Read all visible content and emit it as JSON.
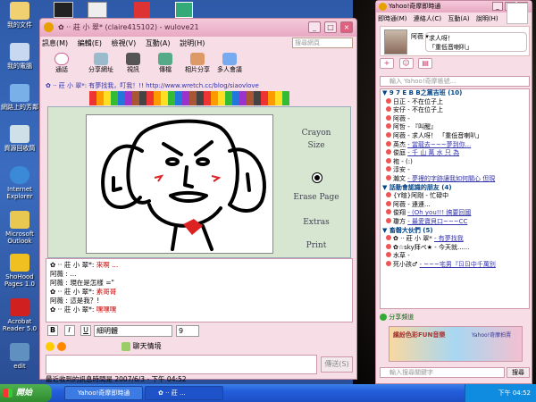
{
  "desktop": {
    "icons": [
      {
        "label": "我的文件"
      },
      {
        "label": "我的電腦"
      },
      {
        "label": "網路上的芳鄰"
      },
      {
        "label": "資源回收筒"
      },
      {
        "label": "Internet Explorer"
      },
      {
        "label": "Microsoft Outlook"
      },
      {
        "label": "ShoHood Pages 1.0"
      },
      {
        "label": "Acrobat Reader 5.0"
      },
      {
        "label": "edit"
      }
    ]
  },
  "chat": {
    "title": "✿ ·· 莊 小 翠* (claire415102) - wulove21",
    "menu": [
      "訊息(M)",
      "編輯(E)",
      "檢視(V)",
      "互動(A)",
      "說明(H)"
    ],
    "search_placeholder": "搜尋網頁",
    "toolbar": [
      {
        "label": "通話"
      },
      {
        "label": "分享網址"
      },
      {
        "label": "視訊"
      },
      {
        "label": "傳檔"
      },
      {
        "label": "相片分享"
      },
      {
        "label": "多人會議"
      }
    ],
    "link_line": "✿ ·· 莊 小 翠*: 有夢找我，叮我！!! http://www.wretch.cc/blog/siaovlove",
    "side_labels": [
      "Crayon",
      "Size",
      "Erase Page",
      "Extras",
      "Print"
    ],
    "messages": [
      {
        "sender": "✿ ·· 莊 小 翠*:",
        "text": "來啊 ..."
      },
      {
        "sender": "阿薇 :",
        "text": "... "
      },
      {
        "sender": "阿薇 :",
        "text": "現在是怎樣 =\""
      },
      {
        "sender": "✿ ·· 莊 小 翠*:",
        "text": "素哥哥"
      },
      {
        "sender": "阿薇 :",
        "text": "這是我？!"
      },
      {
        "sender": "✿ ·· 莊 小 翠*:",
        "text": "嘿嘿嘿"
      }
    ],
    "font_name": "細明體",
    "font_size": "9",
    "emoticon_label": "聊天情境",
    "send_label": "傳送(S)",
    "status": "最近收到的訊息時間是 2007/6/3 - 下午 04:52"
  },
  "messenger": {
    "title": "Yahoo!奇摩即時通",
    "menu": [
      "即時通(M)",
      "連絡人(C)",
      "互動(A)",
      "說明(H)"
    ],
    "profile_name": "阿薇 ▾",
    "profile_status": "求人呀！",
    "profile_music": "「重低音喇叭」",
    "search_placeholder": "輸入 Yahoo!奇摩帳號...",
    "groups": [
      {
        "name": "▼ 9 7 E B B之黨吉班 (10)",
        "contacts": [
          {
            "name": "日正",
            "status": "- 不在位子上"
          },
          {
            "name": "安仔",
            "status": "- 不在位子上"
          },
          {
            "name": "阿薇",
            "status": "-"
          },
          {
            "name": "阿哲",
            "status": "- 『叫醒』"
          },
          {
            "name": "阿薇",
            "status": "- 求人呀！ 「重低音喇叭」"
          },
          {
            "name": "英杰",
            "status": "- 當龍去~~~夢到你..."
          },
          {
            "name": "俊庭",
            "status": "- 千 山 萬 水 只 為"
          },
          {
            "name": "袍",
            "status": "- (:)"
          },
          {
            "name": "淳安",
            "status": "-"
          },
          {
            "name": "瀚文",
            "status": "- 夢裡的字跡讓我如何關心 但現"
          }
        ]
      },
      {
        "name": "▼ 話動會認識的朋友 (4)",
        "contacts": [
          {
            "name": "{Y暄}阿剛",
            "status": "- 忙碌中"
          },
          {
            "name": "阿薇",
            "status": "- 連連..."
          },
          {
            "name": "俊翔",
            "status": "- (Oh you!!! 搞要回國"
          },
          {
            "name": "瓊方",
            "status": "- 最愛寶貝口~~~CC"
          }
        ]
      },
      {
        "name": "▼ 畜磐大伙們 (5)",
        "contacts": [
          {
            "name": "✿ ·· 莊 小 翠*",
            "status": "- 有夢找我"
          },
          {
            "name": "✿☆sky拜ぺ★",
            "status": "- 今天就......"
          },
          {
            "name": "水草",
            "status": "-"
          },
          {
            "name": "死小孩♂",
            "status": "- ~~~宅男『ㄖㄖ中千萬別"
          }
        ]
      }
    ],
    "share_label": "分享頻道",
    "ad_text": "繽紛色彩FUN音樂",
    "ad_brand": "Yahoo!奇摩拍賣",
    "bottom_placeholder": "輸入搜尋關鍵字",
    "bottom_button": "搜尋"
  },
  "taskbar": {
    "start_label": "開始",
    "tasks": [
      {
        "label": "Yahoo!奇摩即時通"
      },
      {
        "label": "✿ ·· 莊 ..."
      }
    ],
    "clock": "下午 04:52"
  }
}
